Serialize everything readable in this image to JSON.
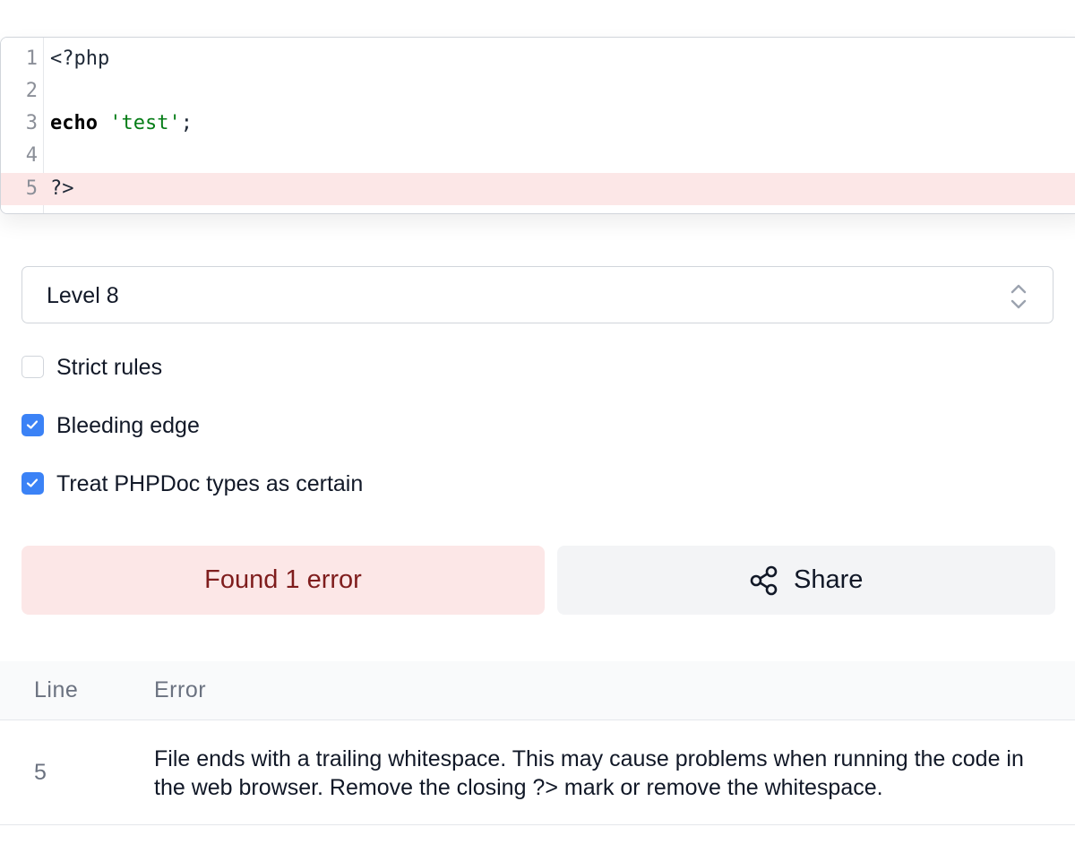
{
  "editor": {
    "lines": [
      {
        "number": "1",
        "text": "<?php"
      },
      {
        "number": "2",
        "text": ""
      },
      {
        "number": "3",
        "keyword": "echo",
        "string": "'test'",
        "punct": ";"
      },
      {
        "number": "4",
        "text": ""
      },
      {
        "number": "5",
        "text": "?>"
      }
    ],
    "error_line": 5
  },
  "level_select": {
    "selected": "Level 8",
    "icon": "chevron-up-down-icon"
  },
  "options": [
    {
      "label": "Strict rules",
      "checked": false
    },
    {
      "label": "Bleeding edge",
      "checked": true
    },
    {
      "label": "Treat PHPDoc types as certain",
      "checked": true
    }
  ],
  "actions": {
    "result_label": "Found 1 error",
    "share_label": "Share",
    "share_icon": "share-icon"
  },
  "errors_table": {
    "headers": {
      "line": "Line",
      "error": "Error"
    },
    "rows": [
      {
        "line": "5",
        "message": "File ends with a trailing whitespace. This may cause problems when running the code in the web browser. Remove the closing ?> mark or remove the whitespace."
      }
    ]
  },
  "colors": {
    "accent": "#3b82f6",
    "error_bg": "#fce7e7",
    "error_text": "#7f1d1d",
    "string": "#067d17"
  }
}
